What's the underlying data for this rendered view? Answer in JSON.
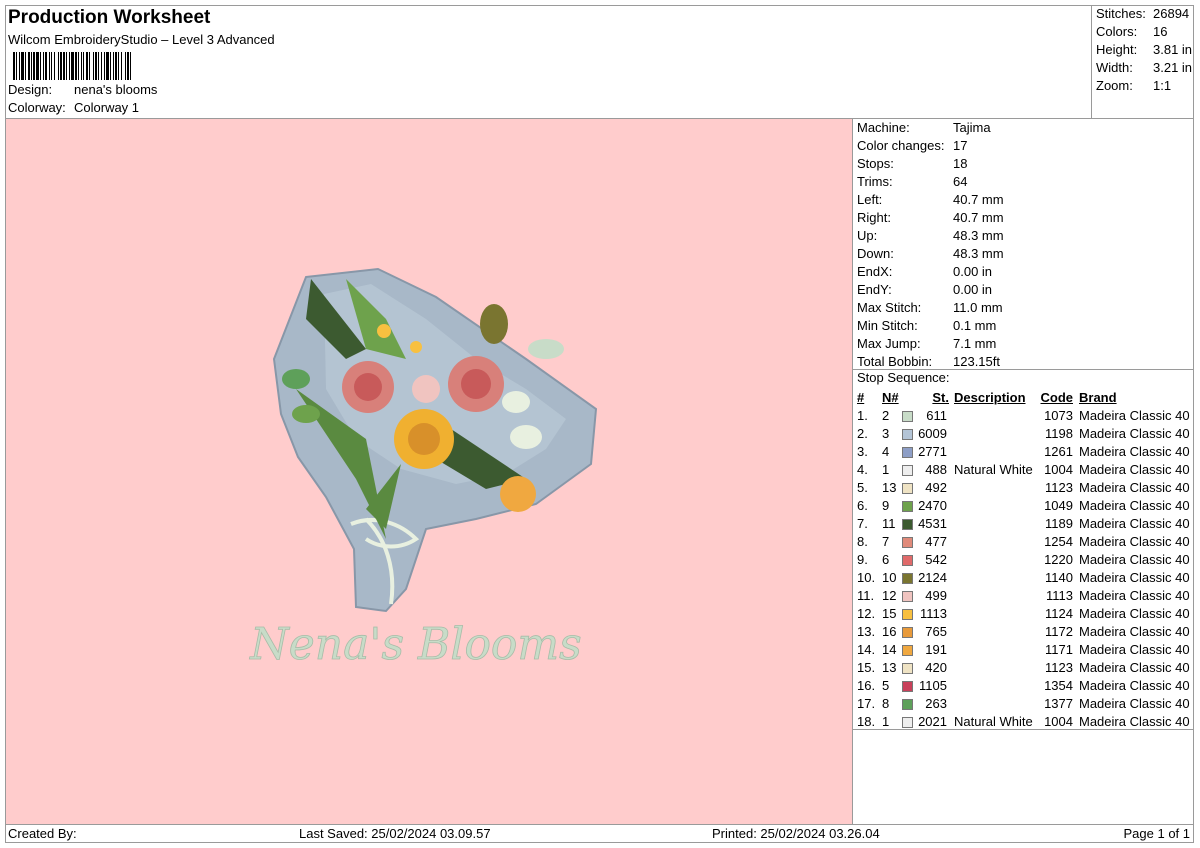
{
  "header": {
    "title": "Production Worksheet",
    "software": "Wilcom EmbroideryStudio – Level 3 Advanced",
    "design_label": "Design:",
    "design_value": "nena's blooms",
    "colorway_label": "Colorway:",
    "colorway_value": "Colorway 1"
  },
  "stats": {
    "stitches_label": "Stitches:",
    "stitches": "26894",
    "colors_label": "Colors:",
    "colors": "16",
    "height_label": "Height:",
    "height": "3.81 in",
    "width_label": "Width:",
    "width": "3.21 in",
    "zoom_label": "Zoom:",
    "zoom": "1:1"
  },
  "machine_info": [
    {
      "label": "Machine:",
      "value": "Tajima"
    },
    {
      "label": "Color changes:",
      "value": "17"
    },
    {
      "label": "Stops:",
      "value": "18"
    },
    {
      "label": "Trims:",
      "value": "64"
    },
    {
      "label": "Left:",
      "value": "40.7 mm"
    },
    {
      "label": "Right:",
      "value": "40.7 mm"
    },
    {
      "label": "Up:",
      "value": "48.3 mm"
    },
    {
      "label": "Down:",
      "value": "48.3 mm"
    },
    {
      "label": "EndX:",
      "value": "0.00 in"
    },
    {
      "label": "EndY:",
      "value": "0.00 in"
    },
    {
      "label": "Max Stitch:",
      "value": "11.0 mm"
    },
    {
      "label": "Min Stitch:",
      "value": "0.1 mm"
    },
    {
      "label": "Max Jump:",
      "value": "7.1 mm"
    },
    {
      "label": "Total Bobbin:",
      "value": "123.15ft"
    }
  ],
  "stop_sequence": {
    "title": "Stop Sequence:",
    "columns": {
      "num": "#",
      "n": "N#",
      "st": "St.",
      "description": "Description",
      "code": "Code",
      "brand": "Brand"
    },
    "rows": [
      {
        "num": "1.",
        "n": "2",
        "color": "#c8dcc8",
        "st": "611",
        "desc": "",
        "code": "1073",
        "brand": "Madeira Classic 40"
      },
      {
        "num": "2.",
        "n": "3",
        "color": "#b3c4d6",
        "st": "6009",
        "desc": "",
        "code": "1198",
        "brand": "Madeira Classic 40"
      },
      {
        "num": "3.",
        "n": "4",
        "color": "#8d9ec6",
        "st": "2771",
        "desc": "",
        "code": "1261",
        "brand": "Madeira Classic 40"
      },
      {
        "num": "4.",
        "n": "1",
        "color": "#eeeeee",
        "st": "488",
        "desc": "Natural White",
        "code": "1004",
        "brand": "Madeira Classic 40"
      },
      {
        "num": "5.",
        "n": "13",
        "color": "#efe3c4",
        "st": "492",
        "desc": "",
        "code": "1123",
        "brand": "Madeira Classic 40"
      },
      {
        "num": "6.",
        "n": "9",
        "color": "#6ea24c",
        "st": "2470",
        "desc": "",
        "code": "1049",
        "brand": "Madeira Classic 40"
      },
      {
        "num": "7.",
        "n": "11",
        "color": "#3c5a30",
        "st": "4531",
        "desc": "",
        "code": "1189",
        "brand": "Madeira Classic 40"
      },
      {
        "num": "8.",
        "n": "7",
        "color": "#e08a7a",
        "st": "477",
        "desc": "",
        "code": "1254",
        "brand": "Madeira Classic 40"
      },
      {
        "num": "9.",
        "n": "6",
        "color": "#e06a6a",
        "st": "542",
        "desc": "",
        "code": "1220",
        "brand": "Madeira Classic 40"
      },
      {
        "num": "10.",
        "n": "10",
        "color": "#7a7530",
        "st": "2124",
        "desc": "",
        "code": "1140",
        "brand": "Madeira Classic 40"
      },
      {
        "num": "11.",
        "n": "12",
        "color": "#f0c4c0",
        "st": "499",
        "desc": "",
        "code": "1113",
        "brand": "Madeira Classic 40"
      },
      {
        "num": "12.",
        "n": "15",
        "color": "#f8c040",
        "st": "1113",
        "desc": "",
        "code": "1124",
        "brand": "Madeira Classic 40"
      },
      {
        "num": "13.",
        "n": "16",
        "color": "#e89a3a",
        "st": "765",
        "desc": "",
        "code": "1172",
        "brand": "Madeira Classic 40"
      },
      {
        "num": "14.",
        "n": "14",
        "color": "#f0a840",
        "st": "191",
        "desc": "",
        "code": "1171",
        "brand": "Madeira Classic 40"
      },
      {
        "num": "15.",
        "n": "13",
        "color": "#efe3c4",
        "st": "420",
        "desc": "",
        "code": "1123",
        "brand": "Madeira Classic 40"
      },
      {
        "num": "16.",
        "n": "5",
        "color": "#c8405a",
        "st": "1105",
        "desc": "",
        "code": "1354",
        "brand": "Madeira Classic 40"
      },
      {
        "num": "17.",
        "n": "8",
        "color": "#5ea05a",
        "st": "263",
        "desc": "",
        "code": "1377",
        "brand": "Madeira Classic 40"
      },
      {
        "num": "18.",
        "n": "1",
        "color": "#eeeeee",
        "st": "2021",
        "desc": "Natural White",
        "code": "1004",
        "brand": "Madeira Classic 40"
      }
    ]
  },
  "design_preview": {
    "lettering": "Nena's Blooms",
    "background_color": "#ffcccc"
  },
  "footer": {
    "created_by": "Created By:",
    "last_saved": "Last Saved: 25/02/2024 03.09.57",
    "printed": "Printed: 25/02/2024 03.26.04",
    "page": "Page 1 of 1"
  }
}
